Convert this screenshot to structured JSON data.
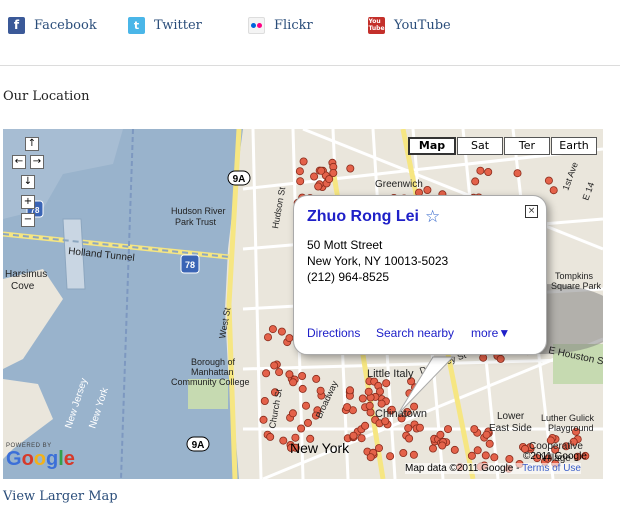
{
  "social": [
    {
      "label": "Facebook",
      "icon": "facebook-icon",
      "color": "#3b5998"
    },
    {
      "label": "Twitter",
      "icon": "twitter-icon",
      "color": "#4ab6e8"
    },
    {
      "label": "Flickr",
      "icon": "flickr-icon",
      "color": "#ff0084"
    },
    {
      "label": "YouTube",
      "icon": "youtube-icon",
      "color": "#c4302b"
    }
  ],
  "section_title": "Our Location",
  "map": {
    "types": [
      "Map",
      "Sat",
      "Ter",
      "Earth"
    ],
    "active_type": "Map",
    "place": {
      "name": "Zhuo Rong Lei",
      "street": "50 Mott Street",
      "city": "New York, NY 10013-5023",
      "phone": "(212) 964-8525",
      "links": [
        "Directions",
        "Search nearby",
        "more▼"
      ]
    },
    "labels": {
      "greenwich": "Greenwich",
      "hudson_park": "Hudson River",
      "hudson_park2": "Park Trust",
      "holland": "Holland Tunnel",
      "harsimus": "Harsimus",
      "cove": "Cove",
      "west_st": "West St",
      "hudson_st": "Hudson St",
      "church_st": "Church St",
      "broadway": "Broadway",
      "bmcc1": "Borough of",
      "bmcc2": "Manhattan",
      "bmcc3": "Community College",
      "newjersey": "New Jersey",
      "newyork_water": "New York",
      "little_italy": "Little Italy",
      "chinatown": "Chinatown",
      "new_york": "New York",
      "lower_east": "Lower",
      "east_side": "East Side",
      "tompkins1": "Tompkins",
      "tompkins2": "Square Park",
      "e_houston": "E Houston St",
      "luther1": "Luther Gulick",
      "luther2": "Playground",
      "coop1": "Cooperative",
      "coop2": "Village",
      "delancey": "Delancey St",
      "route_9a": "9A",
      "route_78": "78",
      "ave_a": "1st Ave",
      "e_14": "E 14"
    },
    "powered_by": "POWERED BY",
    "google": "Google",
    "copyright_year": "©2011 Google",
    "map_data": "Map data ©2011 Google -",
    "terms": "Terms of Use",
    "colors": {
      "water": "#99b3cc",
      "land": "#eae6dc",
      "road": "#ffffff",
      "major_road": "#f6e682",
      "marker": "#e4624a"
    }
  },
  "view_larger": "View Larger Map"
}
